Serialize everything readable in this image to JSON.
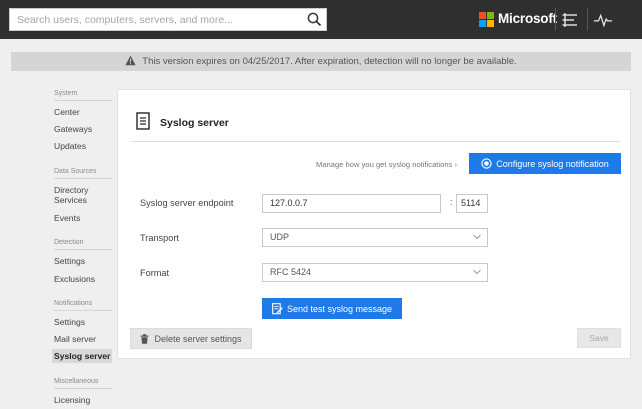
{
  "colors": {
    "topbar": "#2f2f2f",
    "accent": "#1e7ae8",
    "ms_red": "#f25022",
    "ms_green": "#7fba00",
    "ms_blue": "#00a4ef",
    "ms_yellow": "#ffb900"
  },
  "header": {
    "search_placeholder": "Search users, computers, servers, and more...",
    "brand": "Microsoft",
    "icons": [
      "search-icon",
      "microsoft-logo-icon",
      "timeline-icon",
      "health-pulse-icon"
    ]
  },
  "banner": {
    "text": "This version expires on 04/25/2017. After expiration, detection will no longer be available.",
    "icon": "warning-icon"
  },
  "sidebar": {
    "sections": [
      {
        "title": "System",
        "items": [
          "Center",
          "Gateways",
          "Updates"
        ]
      },
      {
        "title": "Data Sources",
        "items": [
          "Directory Services",
          "Events"
        ]
      },
      {
        "title": "Detection",
        "items": [
          "Settings",
          "Exclusions"
        ]
      },
      {
        "title": "Notifications",
        "items": [
          "Settings",
          "Mail server",
          "Syslog server"
        ]
      },
      {
        "title": "Miscellaneous",
        "items": [
          "Licensing"
        ]
      }
    ],
    "directory_line1": "Directory",
    "directory_line2": "Services",
    "active_item": "Syslog server"
  },
  "main": {
    "title": "Syslog server",
    "manage_link": "Manage how you get syslog notifications",
    "configure_button": "Configure syslog notification",
    "fields": {
      "endpoint_label": "Syslog server endpoint",
      "endpoint_host": "127.0.0.7",
      "endpoint_port": "5114",
      "transport_label": "Transport",
      "transport_value": "UDP",
      "format_label": "Format",
      "format_value": "RFC 5424"
    },
    "test_button": "Send test syslog message",
    "delete_button": "Delete server settings",
    "save_button": "Save"
  }
}
